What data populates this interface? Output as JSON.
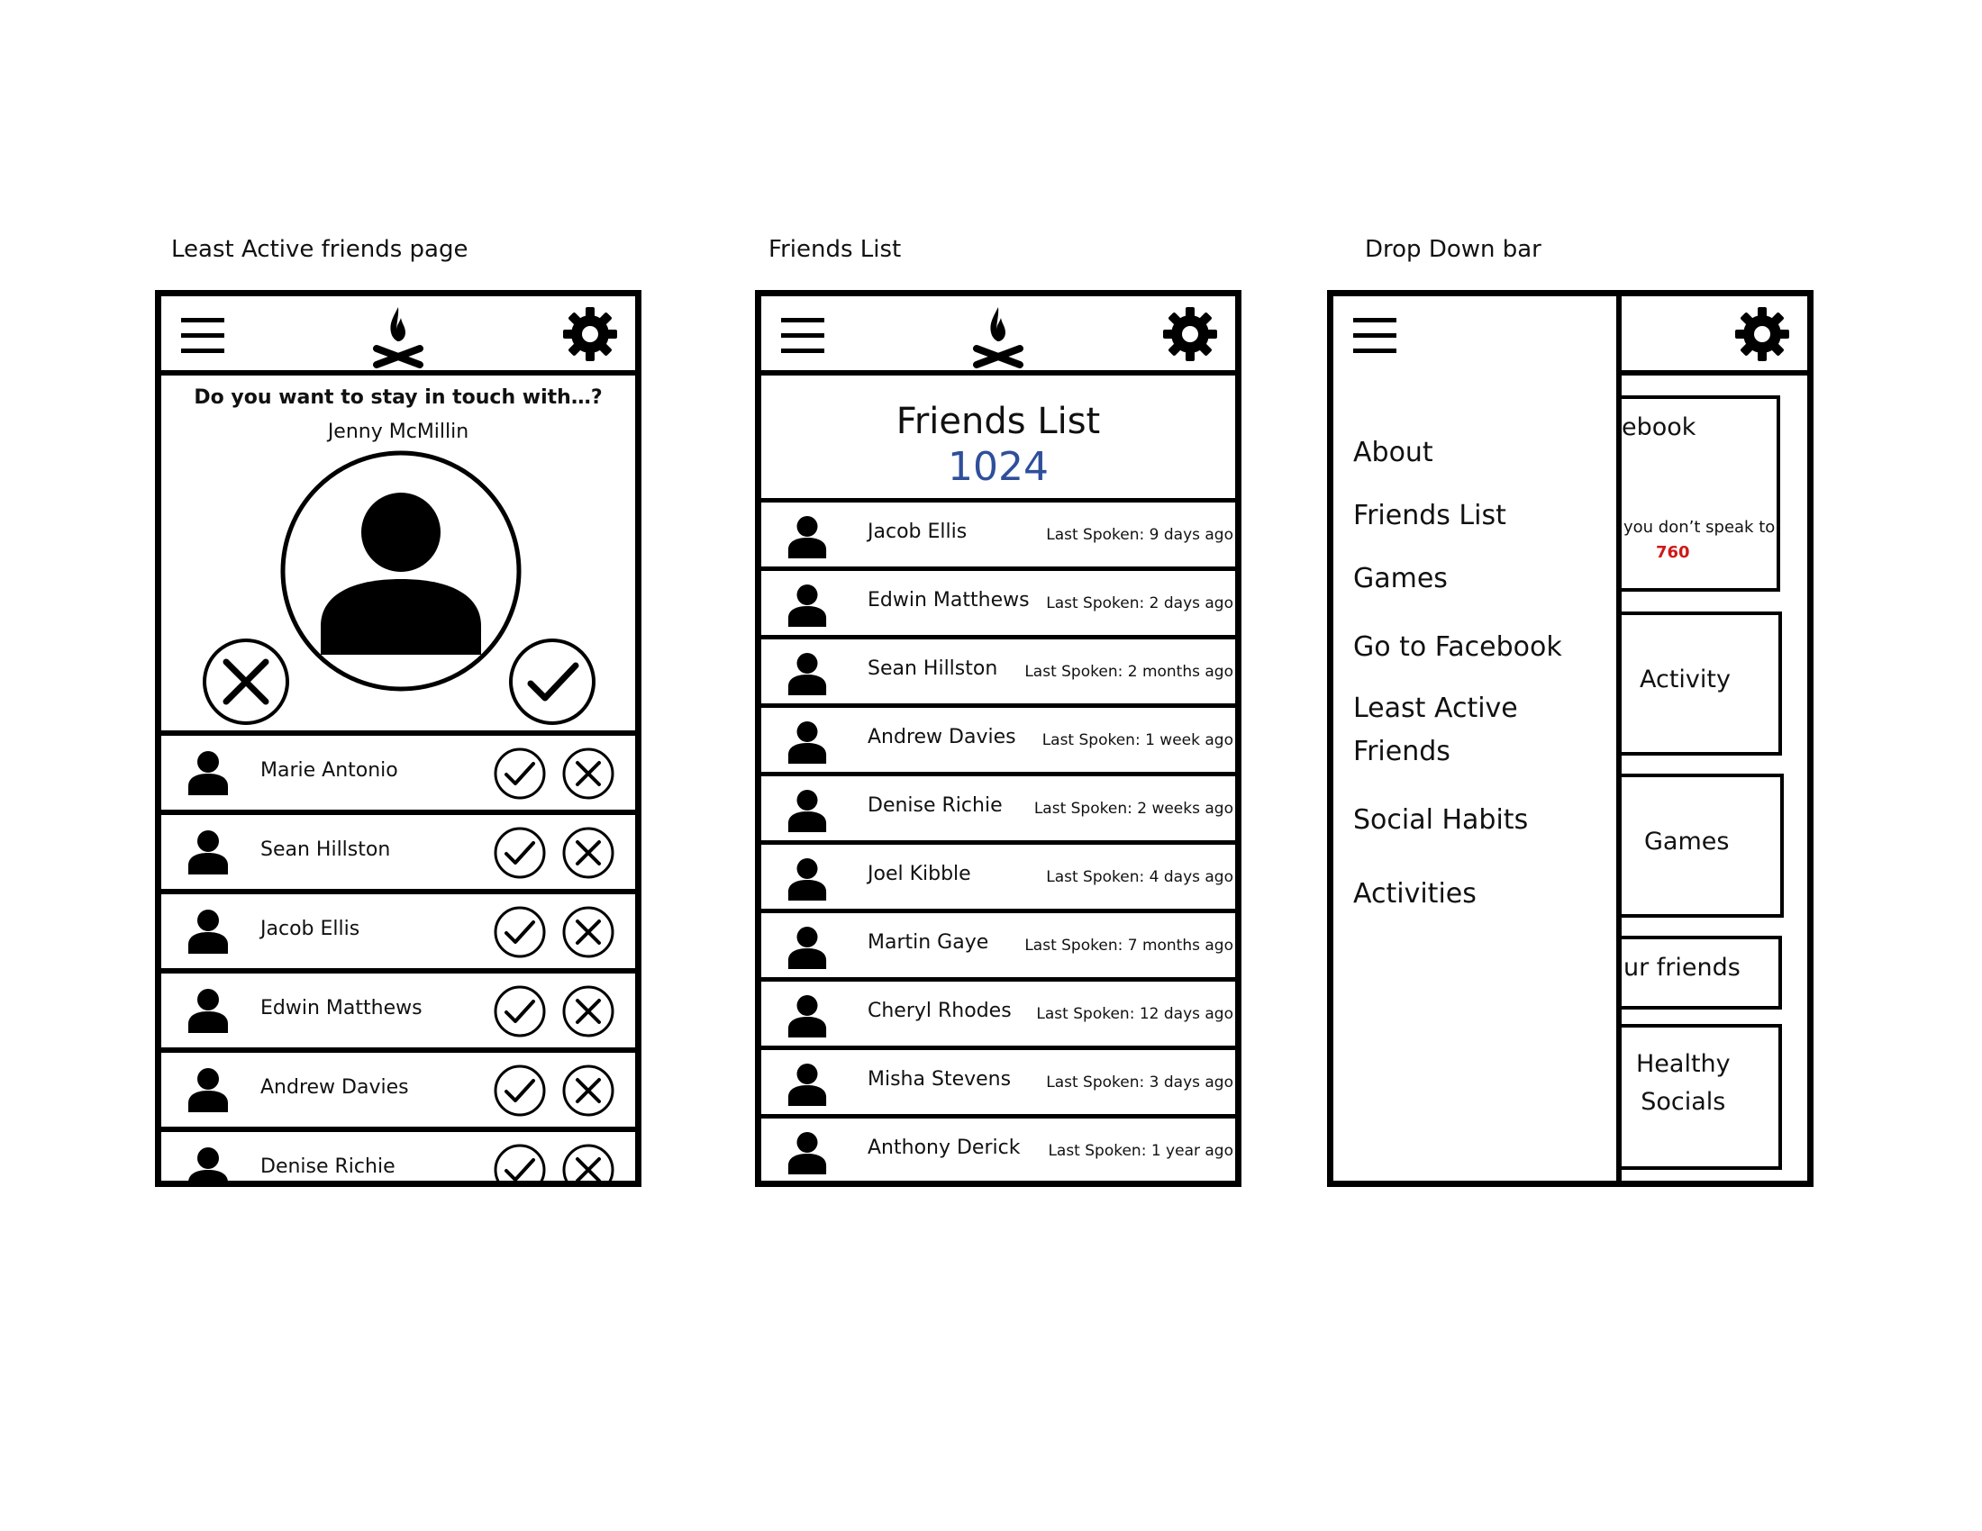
{
  "captions": {
    "least_active": "Least Active friends page",
    "friends_list": "Friends List",
    "drop_down": "Drop Down bar"
  },
  "least_active_page": {
    "question": "Do you want to stay in touch with…?",
    "featured_name": "Jenny McMillin",
    "rows": [
      {
        "name": "Marie Antonio"
      },
      {
        "name": "Sean Hillston"
      },
      {
        "name": "Jacob Ellis"
      },
      {
        "name": "Edwin Matthews"
      },
      {
        "name": "Andrew Davies"
      },
      {
        "name": "Denise Richie"
      }
    ]
  },
  "friends_list_page": {
    "title": "Friends List",
    "count": "1024",
    "rows": [
      {
        "name": "Jacob Ellis",
        "last": "Last Spoken: 9 days ago"
      },
      {
        "name": "Edwin Matthews",
        "last": "Last Spoken: 2 days ago"
      },
      {
        "name": "Sean Hillston",
        "last": "Last Spoken: 2 months ago"
      },
      {
        "name": "Andrew Davies",
        "last": "Last Spoken: 1 week ago"
      },
      {
        "name": "Denise Richie",
        "last": "Last Spoken: 2 weeks ago"
      },
      {
        "name": "Joel Kibble",
        "last": "Last Spoken: 4 days ago"
      },
      {
        "name": "Martin Gaye",
        "last": "Last Spoken: 7 months ago"
      },
      {
        "name": "Cheryl Rhodes",
        "last": "Last Spoken: 12 days ago"
      },
      {
        "name": "Misha Stevens",
        "last": "Last Spoken: 3 days ago"
      },
      {
        "name": "Anthony Derick",
        "last": "Last Spoken: 1 year ago"
      }
    ]
  },
  "drop_down_page": {
    "menu": [
      {
        "label": "About"
      },
      {
        "label": "Friends List"
      },
      {
        "label": "Games"
      },
      {
        "label": "Go to Facebook"
      },
      {
        "label": "Least Active\nFriends"
      },
      {
        "label": "Social Habits"
      },
      {
        "label": "Activities"
      }
    ],
    "cards": {
      "facebook": "ebook",
      "dont_speak": "you don’t speak to:",
      "dont_speak_count": "760",
      "activity": "Activity",
      "games": "Games",
      "friends": "ur friends",
      "healthy": "Healthy\nSocials"
    }
  },
  "colors": {
    "count_blue": "#2f4f9a",
    "count_red": "#d01818"
  }
}
